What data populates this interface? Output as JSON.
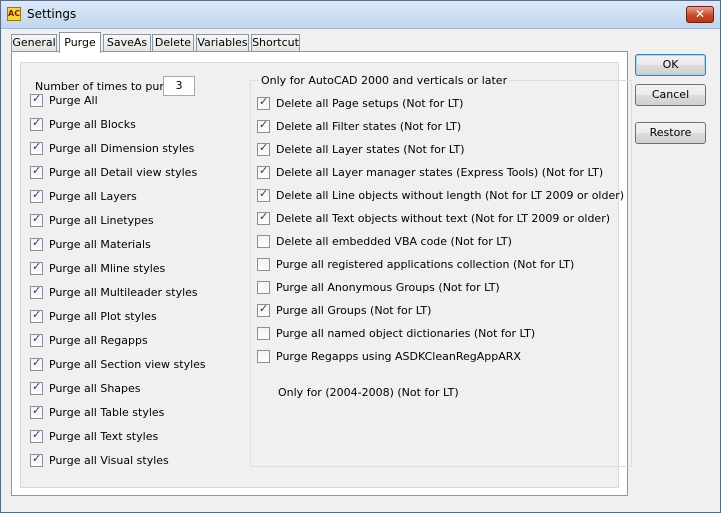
{
  "window": {
    "title": "Settings",
    "close_glyph": "✕",
    "app_icon_text": "AC"
  },
  "tabs": [
    {
      "label": "General",
      "active": false
    },
    {
      "label": "Purge",
      "active": true
    },
    {
      "label": "SaveAs",
      "active": false
    },
    {
      "label": "Delete",
      "active": false
    },
    {
      "label": "Variables",
      "active": false
    },
    {
      "label": "Shortcut",
      "active": false
    }
  ],
  "purge": {
    "count_label": "Number of times to purge:",
    "count_value": "3",
    "left_items": [
      {
        "label": "Purge All",
        "checked": true
      },
      {
        "label": "Purge all Blocks",
        "checked": true
      },
      {
        "label": "Purge all Dimension styles",
        "checked": true
      },
      {
        "label": "Purge all Detail view styles",
        "checked": true
      },
      {
        "label": "Purge all Layers",
        "checked": true
      },
      {
        "label": "Purge all Linetypes",
        "checked": true
      },
      {
        "label": "Purge all Materials",
        "checked": true
      },
      {
        "label": "Purge all Mline styles",
        "checked": true
      },
      {
        "label": "Purge all Multileader styles",
        "checked": true
      },
      {
        "label": "Purge all Plot styles",
        "checked": true
      },
      {
        "label": "Purge all Regapps",
        "checked": true
      },
      {
        "label": "Purge all Section view styles",
        "checked": true
      },
      {
        "label": "Purge all Shapes",
        "checked": true
      },
      {
        "label": "Purge all Table styles",
        "checked": true
      },
      {
        "label": "Purge all Text styles",
        "checked": true
      },
      {
        "label": "Purge all Visual styles",
        "checked": true
      }
    ],
    "group_title": "Only for AutoCAD 2000 and verticals or later",
    "right_items": [
      {
        "label": "Delete all Page setups (Not for LT)",
        "checked": true
      },
      {
        "label": "Delete all Filter states (Not for LT)",
        "checked": true
      },
      {
        "label": "Delete all Layer states (Not for LT)",
        "checked": true
      },
      {
        "label": "Delete all Layer manager states (Express Tools) (Not for LT)",
        "checked": true
      },
      {
        "label": "Delete all Line objects without length (Not for LT 2009 or older)",
        "checked": true
      },
      {
        "label": "Delete all Text objects without text (Not for LT 2009 or older)",
        "checked": true
      },
      {
        "label": "Delete all embedded VBA code (Not for LT)",
        "checked": false
      },
      {
        "label": "Purge all registered applications collection (Not for LT)",
        "checked": false
      },
      {
        "label": "Purge all Anonymous Groups (Not for LT)",
        "checked": false
      },
      {
        "label": "Purge all Groups (Not for LT)",
        "checked": true
      },
      {
        "label": "Purge all named object dictionaries (Not for LT)",
        "checked": false
      },
      {
        "label": "Purge Regapps using ASDKCleanRegAppARX",
        "checked": false
      }
    ],
    "regapps_note": "Only for (2004-2008) (Not for LT)"
  },
  "buttons": {
    "ok": "OK",
    "cancel": "Cancel",
    "restore": "Restore"
  },
  "colors": {
    "check_mark": "#1e3c75",
    "titlebar": "#c2d6ee",
    "close": "#c94a2c"
  }
}
